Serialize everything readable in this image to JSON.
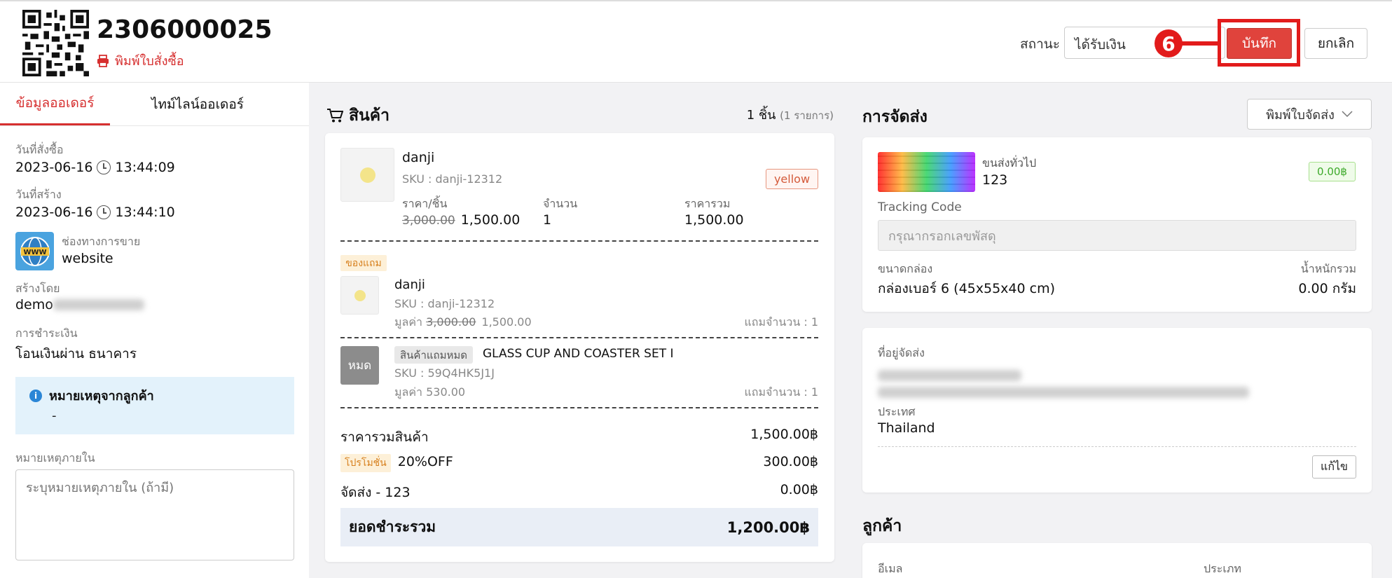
{
  "header": {
    "order_no": "2306000025",
    "print_order_label": "พิมพ์ใบสั่งซื้อ",
    "status_label": "สถานะ",
    "status_value": "ได้รับเงิน",
    "step_number": "6",
    "save_label": "บันทึก",
    "cancel_label": "ยกเลิก"
  },
  "tabs": [
    "ข้อมูลออเดอร์",
    "ไทม์ไลน์ออเดอร์"
  ],
  "order_info": {
    "order_date_label": "วันที่สั่งซื้อ",
    "order_date": "2023-06-16",
    "order_time": "13:44:09",
    "created_date_label": "วันที่สร้าง",
    "created_date": "2023-06-16",
    "created_time": "13:44:10",
    "channel_label": "ช่องทางการขาย",
    "channel_value": "website",
    "channel_icon_text": "WWW",
    "created_by_label": "สร้างโดย",
    "created_by_value": "demo",
    "payment_label": "การชำระเงิน",
    "payment_value": "โอนเงินผ่าน ธนาคาร",
    "customer_note_label": "หมายเหตุจากลูกค้า",
    "customer_note_value": "-",
    "internal_note_label": "หมายเหตุภายใน",
    "internal_note_placeholder": "ระบุหมายเหตุภายใน (ถ้ามี)"
  },
  "products": {
    "title": "สินค้า",
    "count": "1 ชิ้น",
    "count_detail": "(1 รายการ)",
    "main_item": {
      "name": "danji",
      "sku": "SKU : danji-12312",
      "variant": "yellow",
      "unit_price_label": "ราคา/ชิ้น",
      "original_price": "3,000.00",
      "price": "1,500.00",
      "qty_label": "จำนวน",
      "qty": "1",
      "total_label": "ราคารวม",
      "total": "1,500.00"
    },
    "gift_tag": "ของแถม",
    "gift_item": {
      "name": "danji",
      "sku": "SKU : danji-12312",
      "value_label": "มูลค่า",
      "original_value": "3,000.00",
      "value": "1,500.00",
      "gift_qty": "แถมจำนวน : 1"
    },
    "oos_item": {
      "thumb_text": "หมด",
      "tag": "สินค้าแถมหมด",
      "name": "GLASS CUP AND COASTER SET I",
      "sku": "SKU : 59Q4HK5J1J",
      "value": "มูลค่า 530.00",
      "gift_qty": "แถมจำนวน : 1"
    },
    "summary": {
      "subtotal_label": "ราคารวมสินค้า",
      "subtotal": "1,500.00฿",
      "promo_tag": "โปรโมชั่น",
      "promo_name": "20%OFF",
      "promo_value": "300.00฿",
      "shipping_label": "จัดส่ง - 123",
      "shipping_value": "0.00฿",
      "grand_total_label": "ยอดชำระรวม",
      "grand_total": "1,200.00฿"
    }
  },
  "shipping": {
    "title": "การจัดส่ง",
    "print_label": "พิมพ์ใบจัดส่ง",
    "carrier_type": "ขนส่งทั่วไป",
    "carrier_name": "123",
    "carrier_price": "0.00฿",
    "tracking_label": "Tracking Code",
    "tracking_placeholder": "กรุณากรอกเลขพัสดุ",
    "box_label": "ขนาดกล่อง",
    "box_value": "กล่องเบอร์ 6 (45x55x40 cm)",
    "weight_label": "น้ำหนักรวม",
    "weight_value": "0.00 กรัม",
    "address_label": "ที่อยู่จัดส่ง",
    "country_label": "ประเทศ",
    "country_value": "Thailand",
    "edit_label": "แก้ไข"
  },
  "customer": {
    "title": "ลูกค้า",
    "email_label": "อีเมล",
    "type_label": "ประเภท"
  },
  "colors": {
    "accent": "#d62f2f",
    "annotation": "#e21b1b",
    "info_bg": "#e3f2fb"
  }
}
